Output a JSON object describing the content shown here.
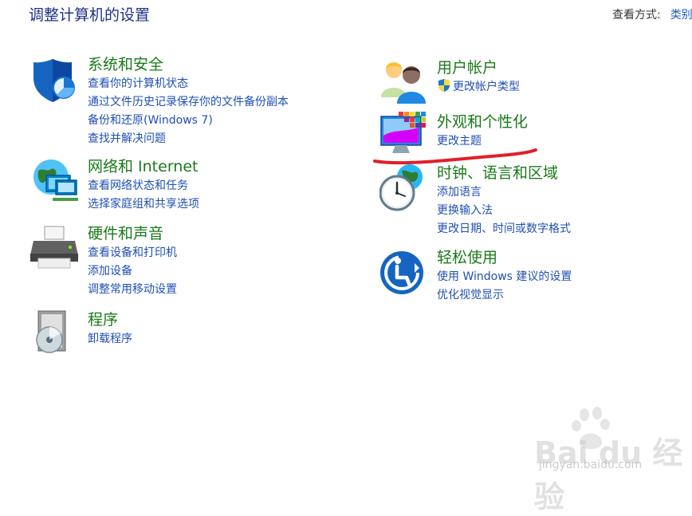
{
  "header": {
    "title": "调整计算机的设置",
    "view_by_label": "查看方式:",
    "view_by_value": "类别"
  },
  "categories": [
    {
      "title": "系统和安全",
      "icon": "shield-security-icon",
      "links": [
        "查看你的计算机状态",
        "通过文件历史记录保存你的文件备份副本",
        "备份和还原(Windows 7)",
        "查找并解决问题"
      ]
    },
    {
      "title": "网络和 Internet",
      "icon": "network-globe-icon",
      "links": [
        "查看网络状态和任务",
        "选择家庭组和共享选项"
      ]
    },
    {
      "title": "硬件和声音",
      "icon": "printer-icon",
      "links": [
        "查看设备和打印机",
        "添加设备",
        "调整常用移动设置"
      ]
    },
    {
      "title": "程序",
      "icon": "programs-disc-icon",
      "links": [
        "卸载程序"
      ]
    },
    {
      "title": "用户帐户",
      "icon": "users-icon",
      "links": [
        "更改帐户类型"
      ]
    },
    {
      "title": "外观和个性化",
      "icon": "monitor-personalize-icon",
      "links": [
        "更改主题"
      ]
    },
    {
      "title": "时钟、语言和区域",
      "icon": "clock-globe-icon",
      "links": [
        "添加语言",
        "更换输入法",
        "更改日期、时间或数字格式"
      ]
    },
    {
      "title": "轻松使用",
      "icon": "ease-of-access-icon",
      "links": [
        "使用 Windows 建议的设置",
        "优化视觉显示"
      ]
    }
  ],
  "watermark": {
    "brand": "Bai du 经验",
    "url": "jingyan.baidu.com"
  },
  "colors": {
    "title_blue": "#1e3287",
    "category_green": "#1a7a1a",
    "link_blue": "#1f4fb4",
    "annotation_red": "#e0202a"
  }
}
